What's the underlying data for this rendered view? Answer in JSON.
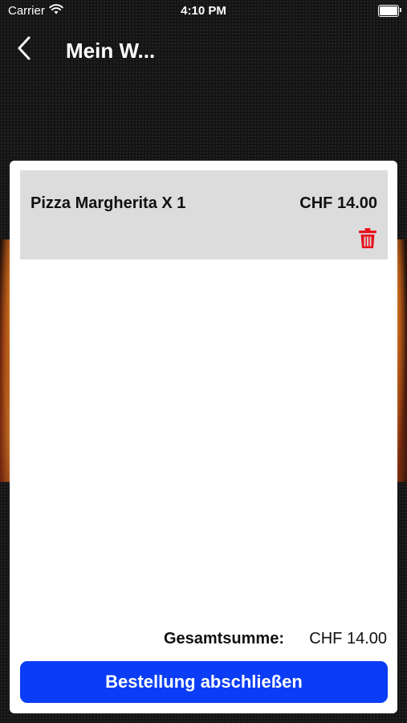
{
  "status_bar": {
    "carrier": "Carrier",
    "time": "4:10 PM",
    "battery_level": 1.0
  },
  "nav": {
    "title": "Mein W...",
    "back_icon": "chevron-left-icon"
  },
  "cart": {
    "items": [
      {
        "name": "Pizza Margherita X 1",
        "price": "CHF 14.00",
        "delete_icon": "trash-icon"
      }
    ],
    "total_label": "Gesamtsumme:",
    "total_value": "CHF 14.00",
    "checkout_label": "Bestellung abschließen"
  },
  "colors": {
    "accent": "#0A3DF5",
    "delete": "#E8121E",
    "item_background": "#DCDCDC",
    "page_background": "#141414"
  }
}
